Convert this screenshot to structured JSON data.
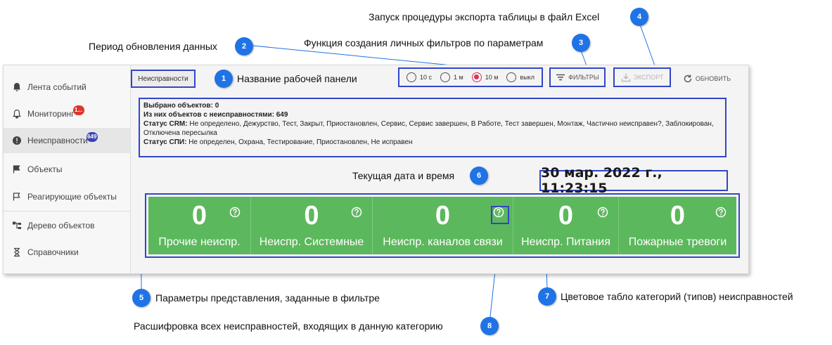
{
  "sidebar": {
    "items": [
      {
        "label": "Лента событий",
        "icon": "bell-icon"
      },
      {
        "label": "Мониторинг",
        "icon": "bell-outline-icon",
        "badge": "1..."
      },
      {
        "label": "Неисправности",
        "icon": "alert-circle-icon",
        "badge": "649"
      },
      {
        "label": "Объекты",
        "icon": "flag-icon"
      },
      {
        "label": "Реагирующие объекты",
        "icon": "flag-outline-icon"
      },
      {
        "label": "Дерево объектов",
        "icon": "tree-icon"
      },
      {
        "label": "Справочники",
        "icon": "hourglass-icon"
      }
    ],
    "active_index": 2
  },
  "header": {
    "panel_name": "Неисправности",
    "refresh_options": [
      {
        "label": "10 с",
        "selected": false
      },
      {
        "label": "1 м",
        "selected": false
      },
      {
        "label": "10 м",
        "selected": true
      },
      {
        "label": "выкл",
        "selected": false
      }
    ],
    "filters_label": "ФИЛЬТРЫ",
    "export_label": "ЭКСПОРТ",
    "refresh_label": "ОБНОВИТЬ"
  },
  "filter_info": {
    "selected_label": "Выбрано объектов:",
    "selected_value": "0",
    "faulty_label": "Из них объектов с неисправностями:",
    "faulty_value": "649",
    "crm_label": "Статус CRM:",
    "crm_value": "Не определено, Дежурство, Тест, Закрыт, Приостановлен, Сервис, Сервис завершен, В Работе, Тест завершен, Монтаж, Частично неисправен?, Заблокирован, Отключена пересылка",
    "spi_label": "Статус СПИ:",
    "spi_value": "Не определен, Охрана, Тестирование, Приостановлен, Не исправен"
  },
  "datetime": "30 мар. 2022 г., 11:23:15",
  "tiles": [
    {
      "value": "0",
      "label": "Прочие неиспр."
    },
    {
      "value": "0",
      "label": "Неиспр. Системные"
    },
    {
      "value": "0",
      "label": "Неиспр. каналов связи"
    },
    {
      "value": "0",
      "label": "Неиспр. Питания"
    },
    {
      "value": "0",
      "label": "Пожарные тревоги"
    }
  ],
  "callouts": {
    "c1": {
      "num": "1",
      "text": "Название рабочей панели"
    },
    "c2": {
      "num": "2",
      "text": "Период обновления данных"
    },
    "c3": {
      "num": "3",
      "text": "Функция создания личных фильтров по параметрам"
    },
    "c4": {
      "num": "4",
      "text": "Запуск процедуры экспорта таблицы в файл Excel"
    },
    "c5": {
      "num": "5",
      "text": "Параметры представления, заданные в фильтре"
    },
    "c6": {
      "num": "6",
      "text": "Текущая дата и время"
    },
    "c7": {
      "num": "7",
      "text": "Цветовое табло категорий (типов) неисправностей"
    },
    "c8": {
      "num": "8",
      "text": "Расшифровка всех неисправностей, входящих в данную категорию"
    }
  },
  "colors": {
    "accent": "#3146c8",
    "callout": "#1f73e6",
    "tile_green": "#5cb85c",
    "radio_selected": "#d9345a"
  }
}
